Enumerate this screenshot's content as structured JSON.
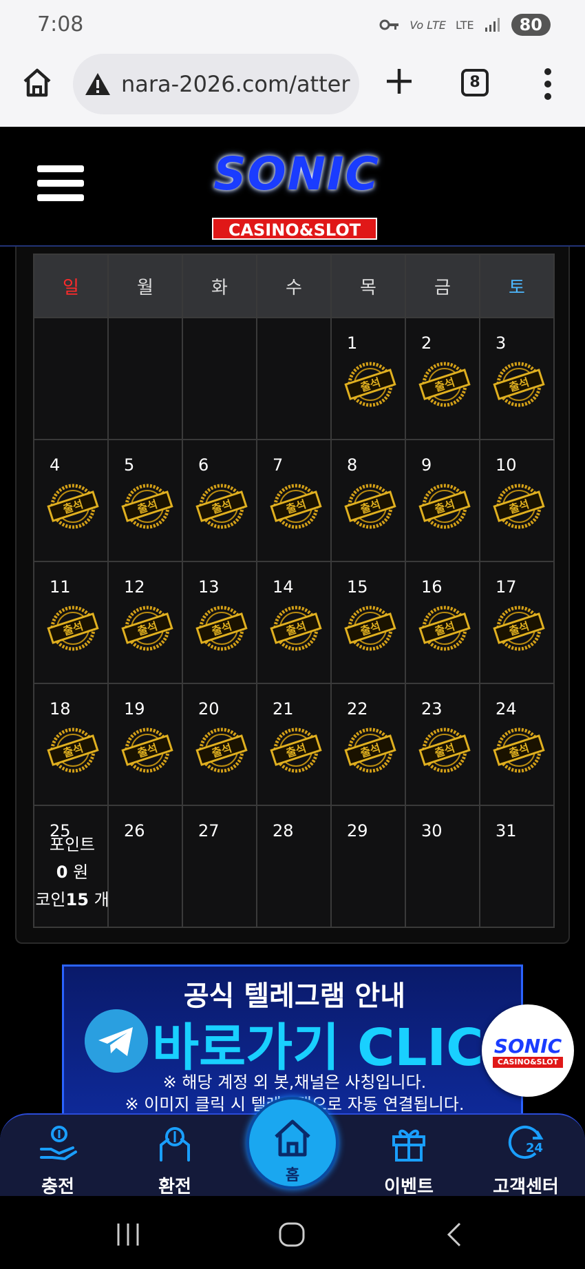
{
  "status_bar": {
    "time": "7:08",
    "signal_text": "Vo LTE",
    "lte_text": "LTE",
    "battery": "80"
  },
  "browser": {
    "url": "nara-2026.com/atter",
    "tab_count": "8",
    "security_icon": "warning-icon"
  },
  "header": {
    "logo_main": "SONIC",
    "logo_sub": "CASINO&SLOT"
  },
  "calendar": {
    "weekdays": [
      "일",
      "월",
      "화",
      "수",
      "목",
      "금",
      "토"
    ],
    "weeks": [
      [
        "",
        "",
        "",
        "",
        "1",
        "2",
        "3"
      ],
      [
        "4",
        "5",
        "6",
        "7",
        "8",
        "9",
        "10"
      ],
      [
        "11",
        "12",
        "13",
        "14",
        "15",
        "16",
        "17"
      ],
      [
        "18",
        "19",
        "20",
        "21",
        "22",
        "23",
        "24"
      ],
      [
        "25",
        "26",
        "27",
        "28",
        "29",
        "30",
        "31"
      ]
    ],
    "stamp_label": "출석",
    "stamped_through": 24,
    "points_label": "포인트",
    "points_value": "0",
    "points_unit": "원",
    "coins_label": "코인",
    "coins_value": "15",
    "coins_unit": "개"
  },
  "banner": {
    "title": "공식 텔레그램 안내",
    "cta": "바로가기 CLICK",
    "note1": "※ 해당 계정 외 봇,채널은 사칭입니다.",
    "note2": "※ 이미지 클릭 시 텔레그램으로 자동 연결됩니다."
  },
  "float_logo": {
    "main": "SONIC",
    "sub": "CASINO&SLOT"
  },
  "bottom_nav": {
    "items": [
      {
        "label": "충전",
        "icon": "deposit-icon"
      },
      {
        "label": "환전",
        "icon": "withdraw-icon"
      },
      {
        "label": "홈",
        "icon": "home-icon"
      },
      {
        "label": "이벤트",
        "icon": "gift-icon"
      },
      {
        "label": "고객센터",
        "icon": "support-24-icon"
      }
    ]
  },
  "colors": {
    "accent": "#1aa7f0",
    "stamp_gold": "#d4a017",
    "sunday": "#ff2a2a",
    "saturday": "#4db8ff"
  }
}
